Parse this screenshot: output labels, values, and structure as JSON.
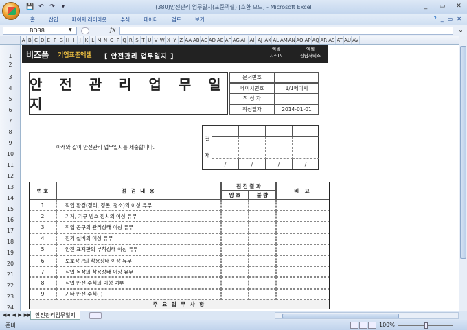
{
  "window": {
    "title": "(380)안전관리 업무일지(표준엑셀) [호환 모드] - Microsoft Excel",
    "controls": [
      "_",
      "▭",
      "✕"
    ]
  },
  "qat": [
    "💾",
    "↶",
    "↷",
    "▾"
  ],
  "ribbon": {
    "tabs": [
      "홈",
      "삽입",
      "페이지 레이아웃",
      "수식",
      "데이터",
      "검토",
      "보기"
    ],
    "help": "?",
    "right_controls": [
      "_",
      "▭",
      "✕"
    ]
  },
  "formula_bar": {
    "name_box": "BD38",
    "fx": "fx",
    "value": ""
  },
  "columns": [
    "A",
    "B",
    "C",
    "D",
    "E",
    "F",
    "G",
    "H",
    "I",
    "J",
    "K",
    "L",
    "M",
    "N",
    "O",
    "P",
    "Q",
    "R",
    "S",
    "T",
    "U",
    "V",
    "W",
    "X",
    "Y",
    "Z",
    "AA",
    "AB",
    "AC",
    "AD",
    "AE",
    "AF",
    "AG",
    "AH",
    "AI",
    "AJ",
    "AK",
    "AL",
    "AM",
    "AN",
    "AO",
    "AP",
    "AQ",
    "AR",
    "AS",
    "AT",
    "AU",
    "AV"
  ],
  "rows": [
    "1",
    "2",
    "3",
    "4",
    "5",
    "6",
    "7",
    "8",
    "9",
    "10",
    "11",
    "12",
    "13",
    "14",
    "15",
    "16",
    "17",
    "18",
    "19",
    "20",
    "21",
    "22",
    "23",
    "24"
  ],
  "banner": {
    "logo": "비즈폼",
    "brand": "기업표준엑셀",
    "title": "[ 안전관리 업무일지 ]",
    "btn1_line1": "엑셀",
    "btn1_line2": "지식IN",
    "btn2_line1": "엑셀",
    "btn2_line2": "상담서비스"
  },
  "doc": {
    "title": "안 전 관 리 업 무 일 지",
    "info_labels": [
      "문서번호",
      "페이지번호",
      "작 성 자",
      "작성일자"
    ],
    "info_values": [
      "",
      "1/1페이지",
      "",
      "2014-01-01"
    ],
    "notice": "아래와 같이 안전관리 업무일지를 제출합니다.",
    "approval_label_1": "결",
    "approval_label_2": "재",
    "approval_dates": [
      "/",
      "/",
      "/",
      "/"
    ]
  },
  "table": {
    "header_no": "번 호",
    "header_content": "점 검 내 용",
    "header_result": "점 검 결 과",
    "header_good": "양 호",
    "header_bad": "불 량",
    "header_remark": "비 고",
    "items": [
      {
        "no": "1",
        "content": "작업 환경(정리, 정돈, 청소)의 이상 유무"
      },
      {
        "no": "2",
        "content": "기계, 기구 방호 장치의 이상 유무"
      },
      {
        "no": "3",
        "content": "작업 공구의 관리상태 이상 유무"
      },
      {
        "no": "4",
        "content": "전기 설비의 이상 유무"
      },
      {
        "no": "5",
        "content": "안전 표지판의 부착상태 이상 유무"
      },
      {
        "no": "6",
        "content": "보호장구의 착용상태 이상 유무"
      },
      {
        "no": "7",
        "content": "작업 복장의 착용상태 이상 유무"
      },
      {
        "no": "8",
        "content": "작업 안전 수칙의 이행 여부"
      },
      {
        "no": "9",
        "content": "기타 안전 수칙(                         )"
      }
    ],
    "footer": "주 요 업 무 사 항"
  },
  "sheet_tabs": {
    "nav": [
      "◀◀",
      "◀",
      "▶",
      "▶▶"
    ],
    "active": "안전관리업무일지"
  },
  "status": {
    "ready": "준비",
    "zoom": "100%"
  }
}
